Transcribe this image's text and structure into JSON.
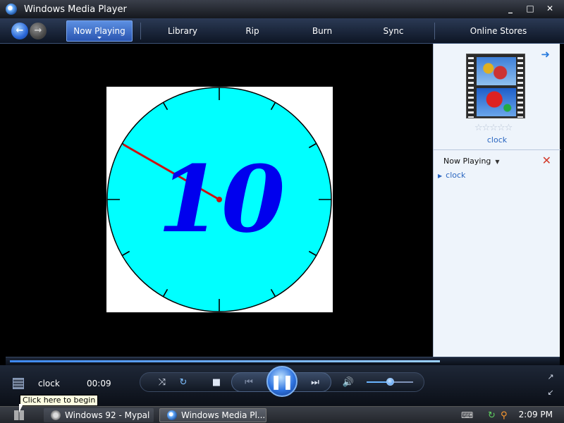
{
  "window": {
    "title": "Windows Media Player",
    "controls": {
      "minimize": "_",
      "maximize": "□",
      "close": "✕"
    }
  },
  "nav": {
    "back_icon": "back-arrow-icon",
    "forward_icon": "forward-arrow-icon",
    "tabs": [
      {
        "label": "Now Playing",
        "active": true
      },
      {
        "label": "Library",
        "active": false
      },
      {
        "label": "Rip",
        "active": false
      },
      {
        "label": "Burn",
        "active": false
      },
      {
        "label": "Sync",
        "active": false
      },
      {
        "label": "Online Stores",
        "active": false
      }
    ]
  },
  "video": {
    "clock_number": "10",
    "clock_face_color": "#00ffff",
    "hand_color": "#cc1111",
    "number_color": "#0000ee"
  },
  "sidepanel": {
    "rating_stars": "☆☆☆☆☆",
    "media_title": "clock",
    "dropdown_label": "Now Playing",
    "playlist": [
      {
        "label": "clock"
      }
    ]
  },
  "playback": {
    "progress_fraction": 0.79,
    "volume_fraction": 0.5
  },
  "controlbar": {
    "media_title": "clock",
    "elapsed": "00:09"
  },
  "tooltip": {
    "text": "Click here to begin"
  },
  "taskbar": {
    "items": [
      {
        "label": "Windows 92 - Mypal"
      },
      {
        "label": "Windows Media Pl..."
      }
    ],
    "time": "2:09 PM"
  }
}
